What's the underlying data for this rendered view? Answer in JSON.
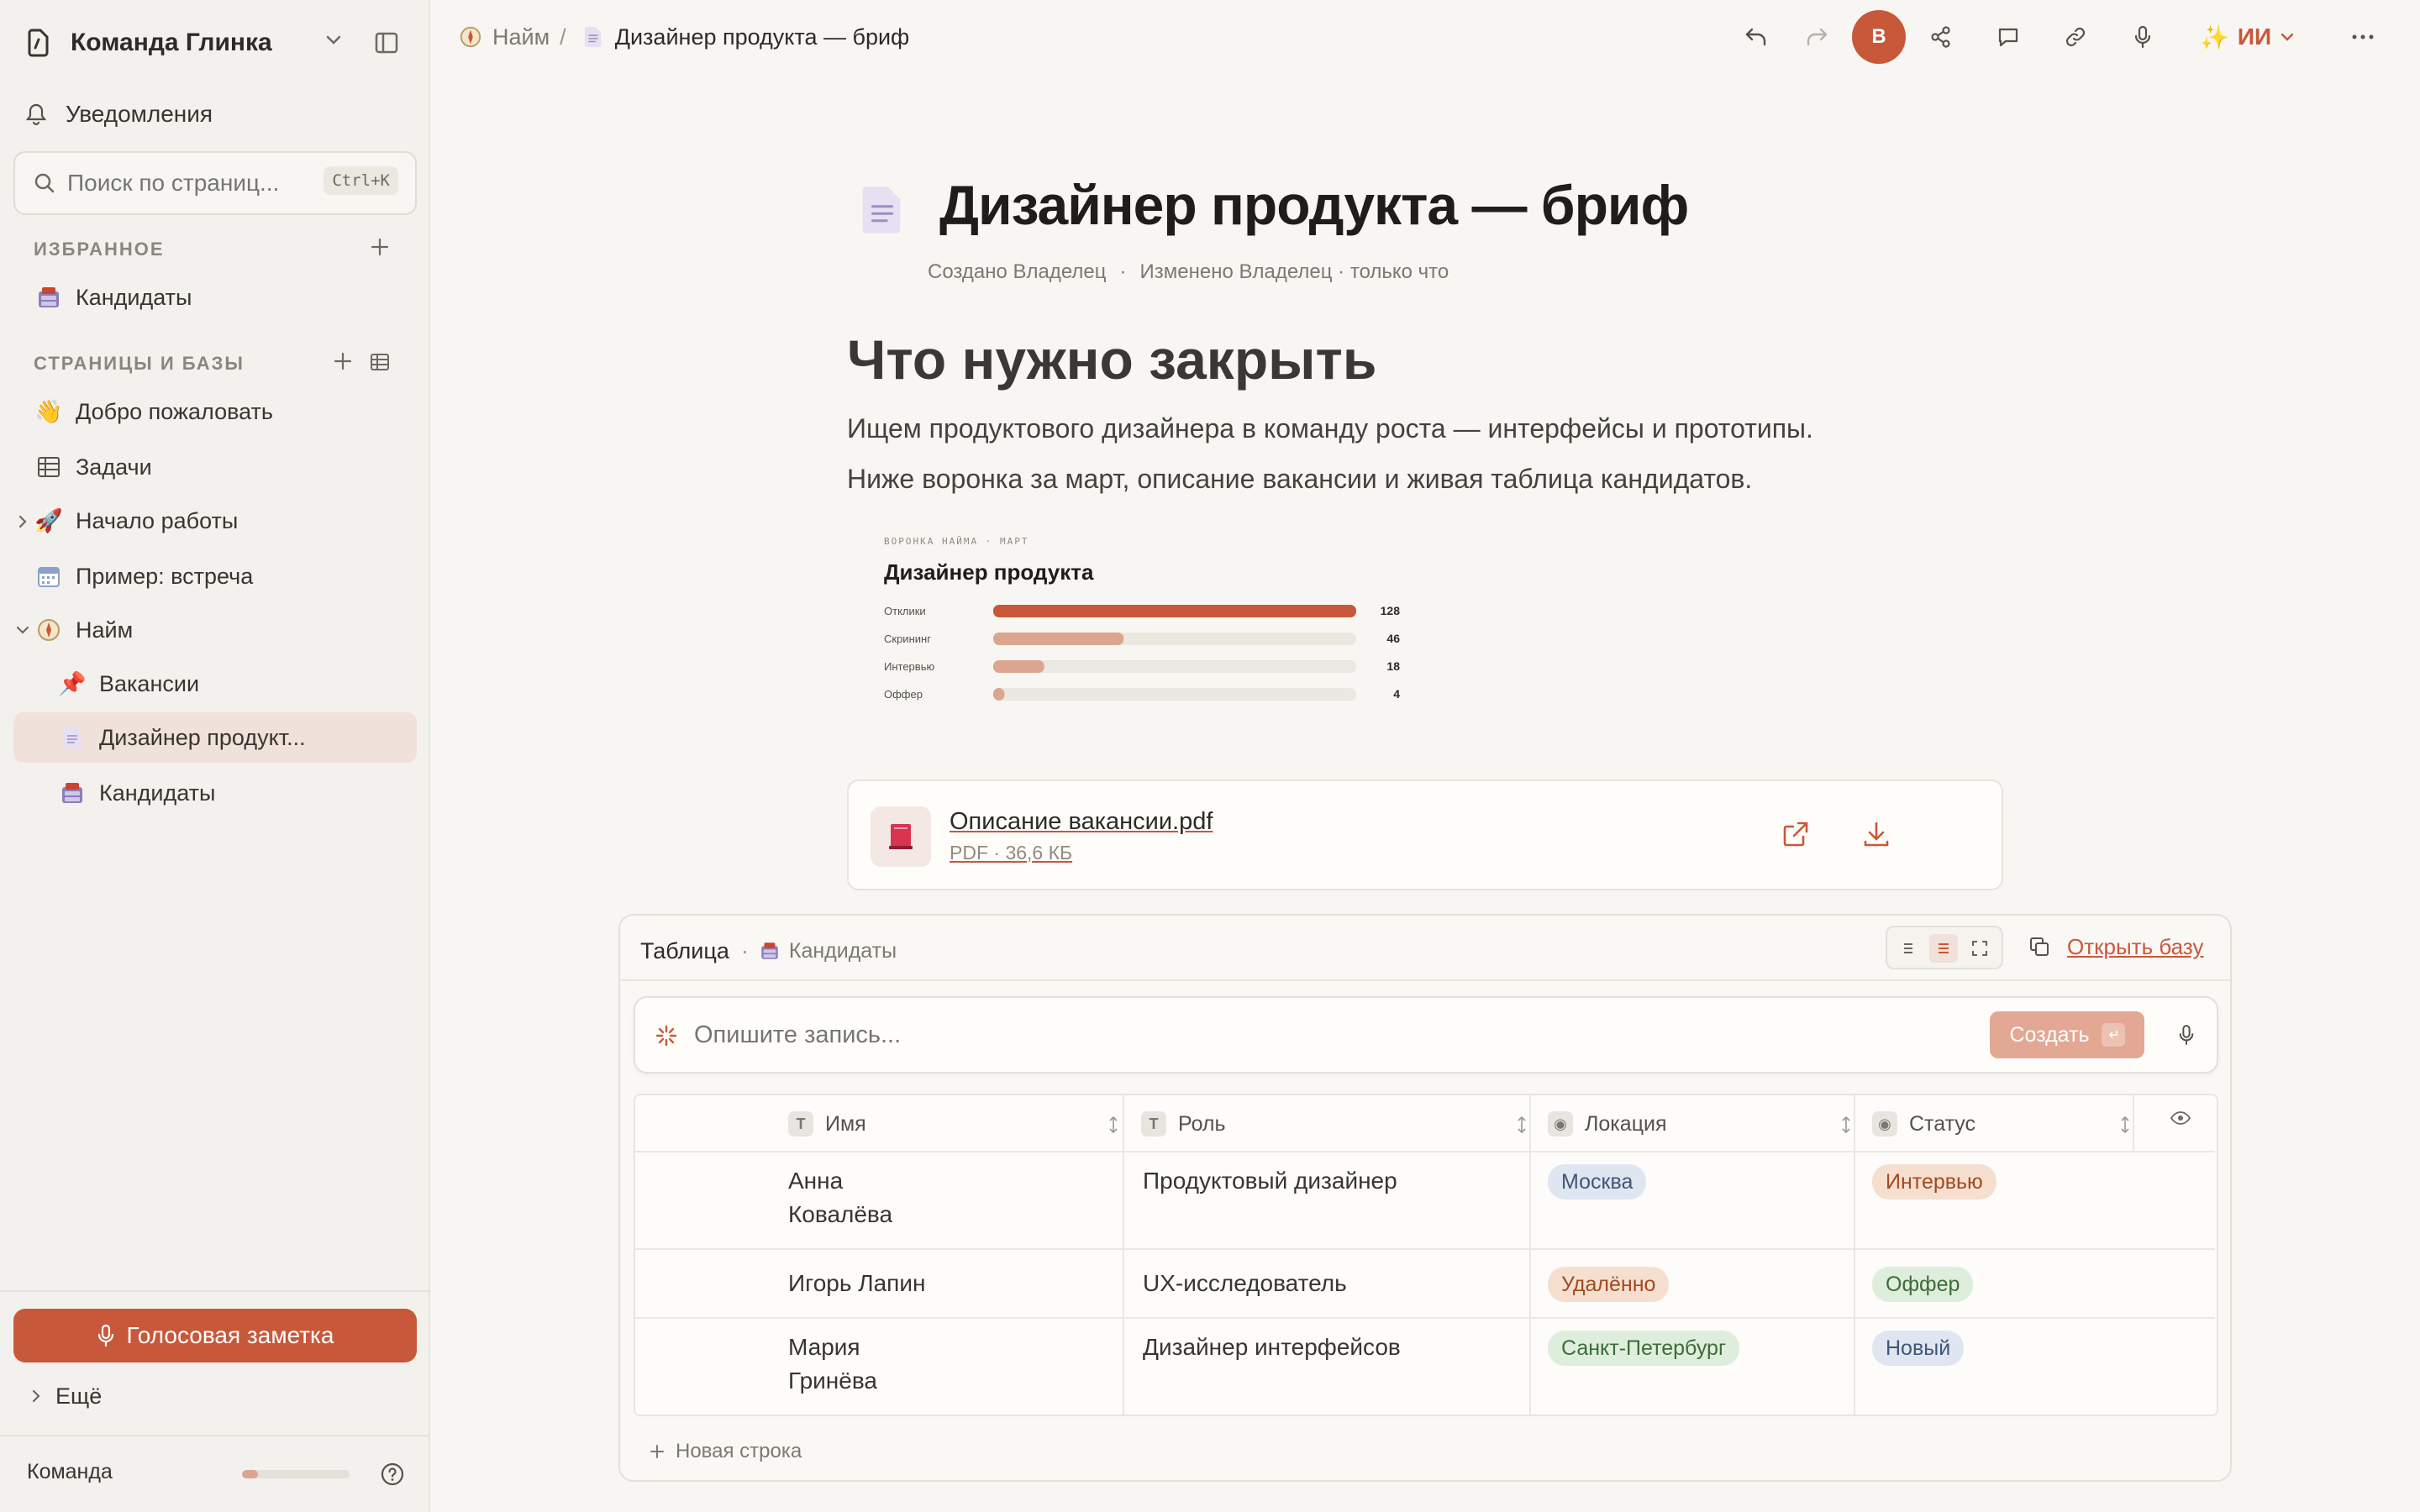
{
  "colors": {
    "accent": "#c8583a",
    "sidebar_bg": "#f3f1ed",
    "main_bg": "#f8f6f2",
    "active_row": "#f0e2da",
    "voice_button": "#c8583a"
  },
  "sidebar": {
    "workspace_name": "Команда Глинка",
    "notifications": "Уведомления",
    "search": {
      "placeholder": "Поиск по страниц...",
      "shortcut": "Ctrl+K"
    },
    "favorites_title": "ИЗБРАННОЕ",
    "favorites": [
      {
        "label": "Кандидаты",
        "icon": "cabinet-icon"
      }
    ],
    "pages_title": "СТРАНИЦЫ И БАЗЫ",
    "pages": [
      {
        "label": "Добро пожаловать",
        "icon": "wave-hand-icon"
      },
      {
        "label": "Задачи",
        "icon": "table-icon"
      },
      {
        "label": "Начало работы",
        "icon": "rocket-icon"
      },
      {
        "label": "Пример: встреча",
        "icon": "calendar-icon"
      },
      {
        "label": "Найм",
        "icon": "compass-icon"
      },
      {
        "label": "Вакансии",
        "icon": "pin-icon"
      },
      {
        "label": "Дизайнер продукт...",
        "icon": "document-icon"
      },
      {
        "label": "Кандидаты",
        "icon": "cabinet-icon"
      }
    ],
    "voice_note": "Голосовая заметка",
    "more": "Ещё",
    "team_label": "Команда",
    "team_progress": 0.15
  },
  "topbar": {
    "breadcrumb_parent": "Найм",
    "breadcrumb_separator": "/",
    "breadcrumb_current": "Дизайнер продукта — бриф",
    "avatar_letter": "В",
    "ai_label": "ИИ"
  },
  "page": {
    "title": "Дизайнер продукта — бриф",
    "meta_created": "Создано Владелец",
    "meta_dot": "·",
    "meta_modified": "Изменено Владелец · только что",
    "heading": "Что нужно закрыть",
    "para1": "Ищем продуктового дизайнера в команду роста — интерфейсы и прототипы.",
    "para2": "Ниже воронка за март, описание вакансии и живая таблица кандидатов."
  },
  "funnel": {
    "kicker": "ВОРОНКА НАЙМА · МАРТ",
    "title": "Дизайнер продукта",
    "max": 128,
    "rows": [
      {
        "label": "Отклики",
        "value": 128,
        "color": "#c8583a"
      },
      {
        "label": "Скрининг",
        "value": 46,
        "color": "#dca58f"
      },
      {
        "label": "Интервью",
        "value": 18,
        "color": "#dca58f"
      },
      {
        "label": "Оффер",
        "value": 4,
        "color": "#dca58f"
      }
    ]
  },
  "file": {
    "name": "Описание вакансии.pdf",
    "meta": "PDF · 36,6 КБ"
  },
  "database": {
    "view_label": "Таблица",
    "dot": "·",
    "source_label": "Кандидаты",
    "open_label": "Открыть базу",
    "prompt_placeholder": "Опишите запись...",
    "create_label": "Создать",
    "columns": [
      {
        "label": "Имя",
        "badge": "T"
      },
      {
        "label": "Роль",
        "badge": "T"
      },
      {
        "label": "Локация",
        "badge": "◉"
      },
      {
        "label": "Статус",
        "badge": "◉"
      }
    ],
    "rows": [
      {
        "name_line1": "Анна",
        "name_line2": "Ковалёва",
        "role": "Продуктовый дизайнер",
        "location": "Москва",
        "status": "Интервью"
      },
      {
        "name_line1": "Игорь Лапин",
        "name_line2": "",
        "role": "UX-исследователь",
        "location": "Удалённо",
        "status": "Оффер"
      },
      {
        "name_line1": "Мария",
        "name_line2": "Гринёва",
        "role": "Дизайнер интерфейсов",
        "location": "Санкт-Петербург",
        "status": "Новый"
      }
    ],
    "new_row_label": "Новая строка"
  }
}
